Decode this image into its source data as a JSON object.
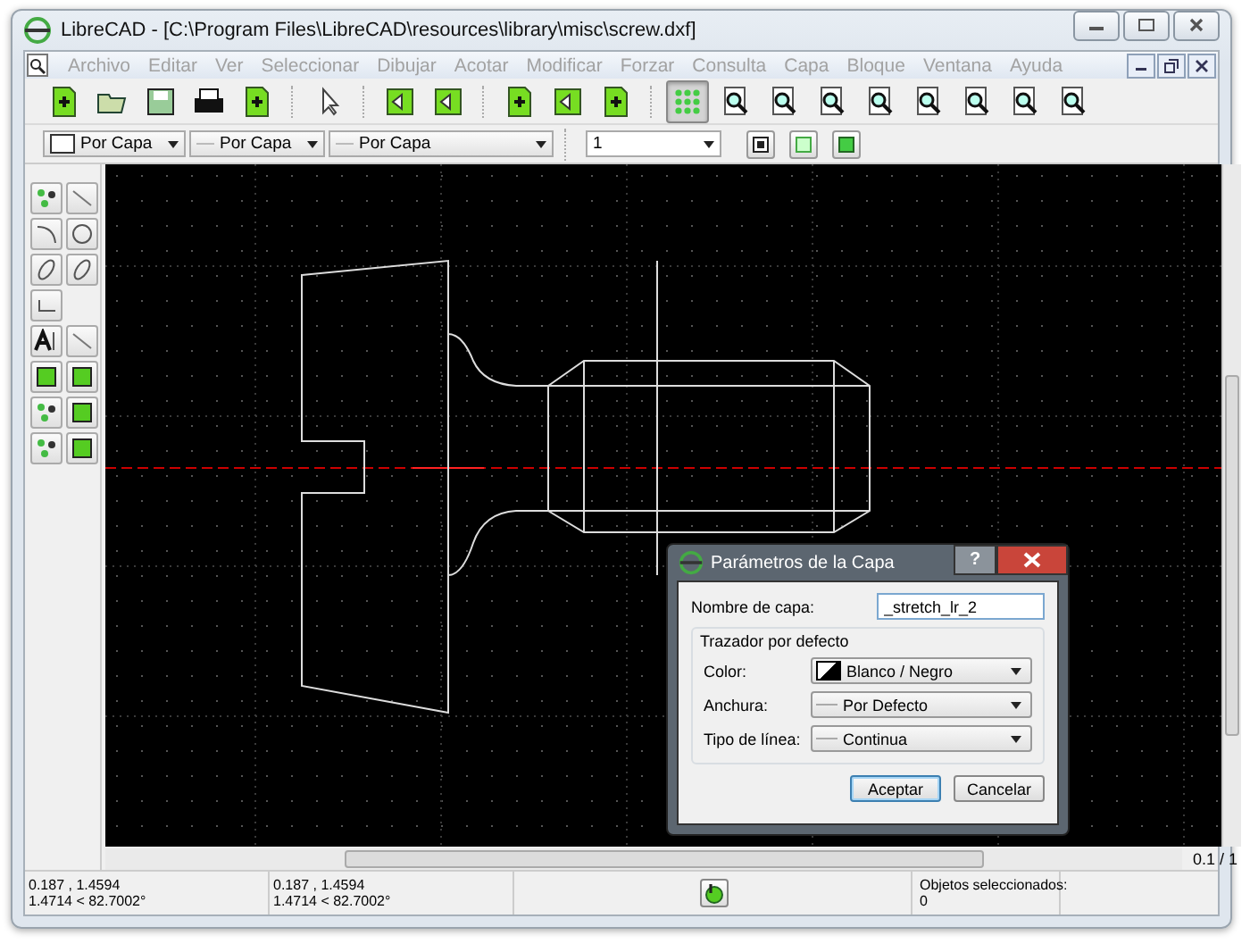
{
  "window": {
    "title": "LibreCAD - [C:\\Program Files\\LibreCAD\\resources\\library\\misc\\screw.dxf]"
  },
  "menu": [
    {
      "label": "Archivo",
      "disabled": true
    },
    {
      "label": "Editar",
      "disabled": true
    },
    {
      "label": "Ver",
      "disabled": true
    },
    {
      "label": "Seleccionar",
      "disabled": true
    },
    {
      "label": "Dibujar",
      "disabled": true
    },
    {
      "label": "Acotar",
      "disabled": true
    },
    {
      "label": "Modificar",
      "disabled": true
    },
    {
      "label": "Forzar",
      "disabled": true
    },
    {
      "label": "Consulta",
      "disabled": true
    },
    {
      "label": "Capa",
      "disabled": true
    },
    {
      "label": "Bloque",
      "disabled": true
    },
    {
      "label": "Ventana",
      "disabled": true
    },
    {
      "label": "Ayuda",
      "disabled": true
    }
  ],
  "toolbar": {
    "grid_on": true
  },
  "property_toolbar": {
    "color_dropdown": "Por Capa",
    "width": "Por Capa",
    "linetype": "Por Capa",
    "layer": "1"
  },
  "scroll": {
    "page_label": "0.1 / 1"
  },
  "dialog": {
    "title": "Parámetros de la Capa",
    "help": "?",
    "name_label": "Nombre de capa:",
    "name_value": "_stretch_lr_2",
    "group_title": "Trazador por defecto",
    "fields": [
      {
        "label": "Color:",
        "value": "Blanco / Negro",
        "kind": "color"
      },
      {
        "label": "Anchura:",
        "value": "Por Defecto",
        "kind": "line"
      },
      {
        "label": "Tipo de línea:",
        "value": "Continua",
        "kind": "line"
      }
    ],
    "buttons": [
      {
        "label": "Aceptar",
        "default": true
      },
      {
        "label": "Cancelar",
        "default": false
      }
    ]
  },
  "status_bar": {
    "coords": [
      {
        "line1": "0.187 , 1.4594",
        "line2": "1.4714 < 82.7002°"
      },
      {
        "line1": "0.187 , 1.4594",
        "line2": "1.4714 < 82.7002°"
      }
    ],
    "selected_label": "Objetos seleccionados:",
    "selected_count": "0"
  }
}
